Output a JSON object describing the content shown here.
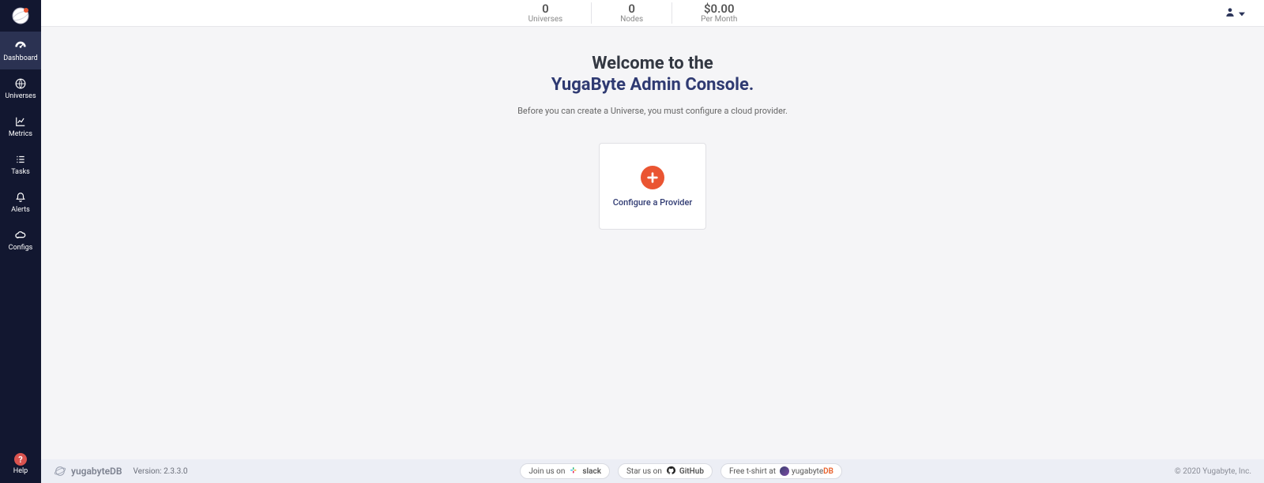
{
  "sidebar": {
    "items": [
      {
        "label": "Dashboard"
      },
      {
        "label": "Universes"
      },
      {
        "label": "Metrics"
      },
      {
        "label": "Tasks"
      },
      {
        "label": "Alerts"
      },
      {
        "label": "Configs"
      }
    ],
    "help_label": "Help"
  },
  "topbar": {
    "stats": [
      {
        "value": "0",
        "label": "Universes"
      },
      {
        "value": "0",
        "label": "Nodes"
      },
      {
        "value": "$0.00",
        "label": "Per Month"
      }
    ]
  },
  "main": {
    "welcome_line1": "Welcome to the",
    "welcome_line2": "YugaByte Admin Console.",
    "subtext": "Before you can create a Universe, you must configure a cloud provider.",
    "card_label": "Configure a Provider"
  },
  "footer": {
    "brand": "yugabyteDB",
    "version": "Version: 2.3.3.0",
    "slack_prefix": "Join us on",
    "slack_label": "slack",
    "github_prefix": "Star us on",
    "github_label": "GitHub",
    "tshirt_prefix": "Free t-shirt at",
    "tshirt_brand_a": "yugabyte",
    "tshirt_brand_b": "DB",
    "copyright": "© 2020 Yugabyte, Inc."
  }
}
